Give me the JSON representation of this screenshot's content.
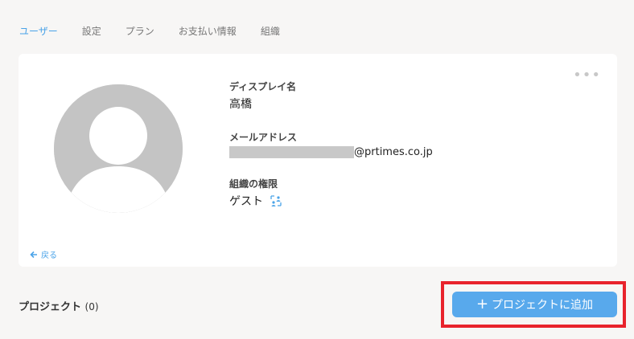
{
  "tabs": [
    {
      "label": "ユーザー",
      "active": true
    },
    {
      "label": "設定"
    },
    {
      "label": "プラン"
    },
    {
      "label": "お支払い情報"
    },
    {
      "label": "組織"
    }
  ],
  "profile": {
    "display_name_label": "ディスプレイ名",
    "display_name": "高橋",
    "email_label": "メールアドレス",
    "email_domain": "@prtimes.co.jp",
    "role_label": "組織の権限",
    "role": "ゲスト"
  },
  "back_label": "戻る",
  "projects": {
    "title": "プロジェクト",
    "count": "(0)"
  },
  "add_button_label": "プロジェクトに追加",
  "icons": [
    "more-icon",
    "avatar-icon",
    "role-switch-icon",
    "back-arrow-icon",
    "plus-icon"
  ],
  "colors": {
    "accent": "#58a9ec",
    "highlight": "#e8232c"
  }
}
